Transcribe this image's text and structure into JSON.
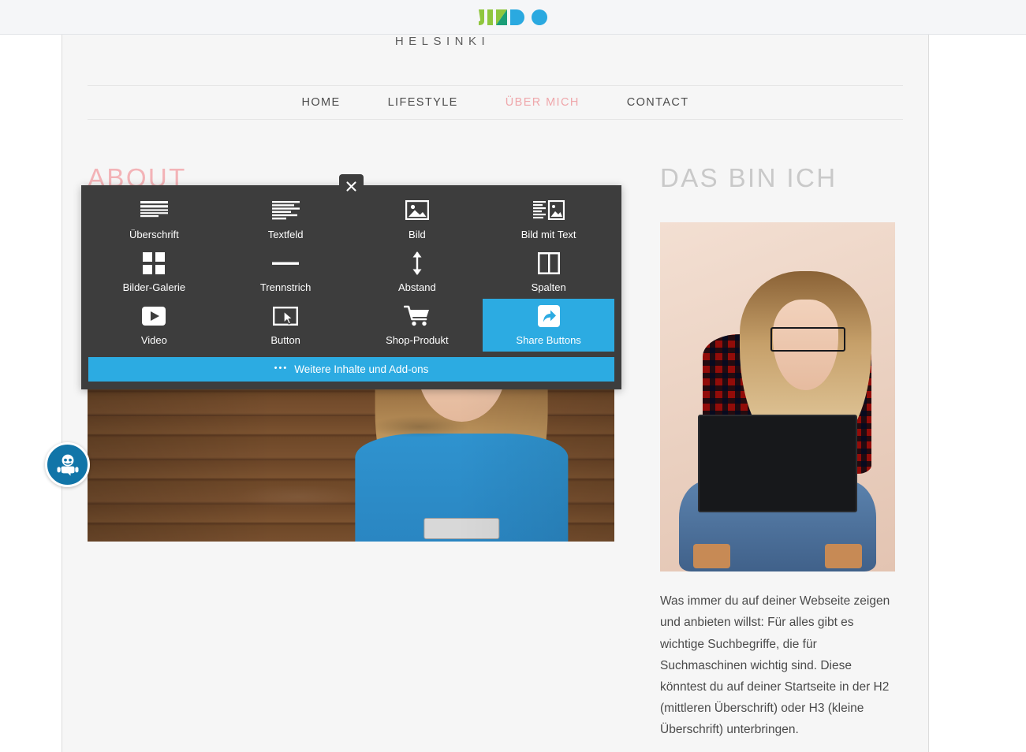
{
  "app": {
    "brand": "JIMDO",
    "brand_letters": [
      "J",
      "I",
      "M",
      "D",
      "O"
    ]
  },
  "site": {
    "brand_name": "HELSINKI",
    "nav": [
      {
        "label": "HOME",
        "active": false
      },
      {
        "label": "LIFESTYLE",
        "active": false
      },
      {
        "label": "ÜBER MICH",
        "active": true
      },
      {
        "label": "CONTACT",
        "active": false
      }
    ],
    "left_column": {
      "heading": "ABOUT",
      "image_alt": "woman-with-camera-wooden-wall-photo"
    },
    "right_column": {
      "heading": "DAS BIN ICH",
      "image_alt": "woman-with-laptop-sitting-photo",
      "paragraph": "Was immer du auf deiner Webseite zeigen und anbieten willst: Für alles gibt es wichtige Suchbegriffe, die für Suchmaschinen wichtig sind. Diese könntest du auf deiner Startseite in der H2 (mittleren Überschrift) oder H3 (kleine Überschrift) unterbringen."
    }
  },
  "element_picker": {
    "close_label": "×",
    "selected_index": 11,
    "items": [
      {
        "label": "Überschrift",
        "icon": "heading-icon"
      },
      {
        "label": "Textfeld",
        "icon": "text-field-icon"
      },
      {
        "label": "Bild",
        "icon": "image-icon"
      },
      {
        "label": "Bild mit Text",
        "icon": "image-with-text-icon"
      },
      {
        "label": "Bilder-Galerie",
        "icon": "gallery-grid-icon"
      },
      {
        "label": "Trennstrich",
        "icon": "horizontal-rule-icon"
      },
      {
        "label": "Abstand",
        "icon": "vertical-spacing-arrow-icon"
      },
      {
        "label": "Spalten",
        "icon": "columns-icon"
      },
      {
        "label": "Video",
        "icon": "video-play-icon"
      },
      {
        "label": "Button",
        "icon": "button-cursor-icon"
      },
      {
        "label": "Shop-Produkt",
        "icon": "shopping-cart-icon"
      },
      {
        "label": "Share Buttons",
        "icon": "share-arrow-icon"
      }
    ],
    "more_label": "Weitere Inhalte und Add-ons",
    "more_dots": "•••"
  },
  "chat_widget": {
    "icon": "chat-bot-icon"
  },
  "colors": {
    "accent_blue": "#2cabe2",
    "panel_dark": "#3d3d3d",
    "nav_active_pink": "#efa7ab",
    "heading_pink": "#f3b3b7",
    "heading_gray": "#c9c9c9",
    "chat_blue": "#1175a8",
    "jimdo_green": "#8fc63d",
    "jimdo_teal": "#1b9e77",
    "jimdo_blue": "#2aa9e0"
  }
}
